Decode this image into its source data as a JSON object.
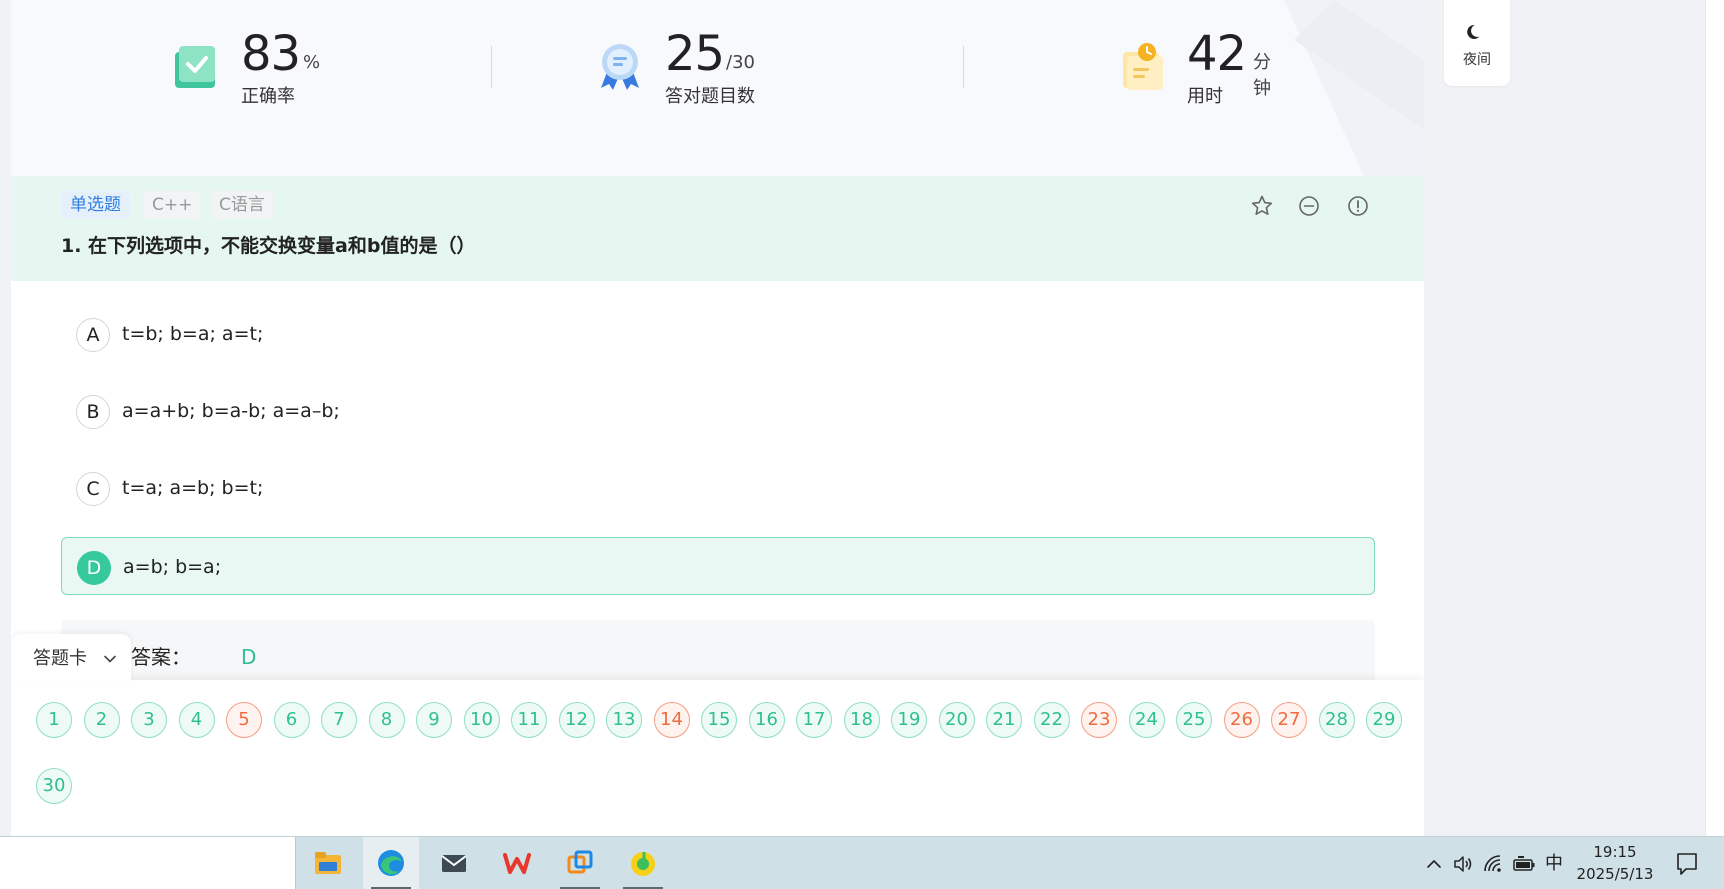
{
  "stats": [
    {
      "value": "83",
      "unit": "%",
      "label": "正确率",
      "icon": "check-book-icon"
    },
    {
      "value": "25",
      "unit": "/30",
      "label": "答对题目数",
      "icon": "award-medal-icon"
    },
    {
      "value": "42",
      "unit": "分钟",
      "label": "用时",
      "icon": "clock-clipboard-icon"
    }
  ],
  "night_mode": {
    "label": "夜间",
    "icon": "moon-icon"
  },
  "question": {
    "type_tag": "单选题",
    "tags": [
      "C++",
      "C语言"
    ],
    "title": "1. 在下列选项中，不能交换变量a和b值的是（）",
    "actions": [
      "star-icon",
      "minus-circle-icon",
      "report-icon"
    ],
    "options": [
      {
        "letter": "A",
        "text": "t=b; b=a; a=t;",
        "selected": false
      },
      {
        "letter": "B",
        "text": "a=a+b; b=a-b; a=a–b;",
        "selected": false
      },
      {
        "letter": "C",
        "text": "t=a; a=b; b=t;",
        "selected": false
      },
      {
        "letter": "D",
        "text": "a=b; b=a;",
        "selected": true
      }
    ],
    "answer_label": "答案：",
    "answer_value": "D"
  },
  "answer_card": {
    "label": "答题卡",
    "numbers": [
      "1",
      "2",
      "3",
      "4",
      "5",
      "6",
      "7",
      "8",
      "9",
      "10",
      "11",
      "12",
      "13",
      "14",
      "15",
      "16",
      "17",
      "18",
      "19",
      "20",
      "21",
      "22",
      "23",
      "24",
      "25",
      "26",
      "27",
      "28",
      "29",
      "30"
    ],
    "wrong": [
      "5",
      "14",
      "23",
      "26",
      "27"
    ]
  },
  "taskbar": {
    "apps": [
      {
        "name": "file-explorer-icon",
        "active": false
      },
      {
        "name": "edge-browser-icon",
        "active": true
      },
      {
        "name": "mail-icon",
        "active": false
      },
      {
        "name": "wps-office-icon",
        "active": false
      },
      {
        "name": "window-manager-icon",
        "active": false
      },
      {
        "name": "music-app-icon",
        "active": false
      }
    ],
    "ime": "中",
    "time": "19:15",
    "date": "2025/5/13"
  },
  "colors": {
    "accent": "#35c99c",
    "wrong": "#f06b3f",
    "tag_blue": "#2e7fe0",
    "question_header_bg": "#e6f6f1"
  }
}
